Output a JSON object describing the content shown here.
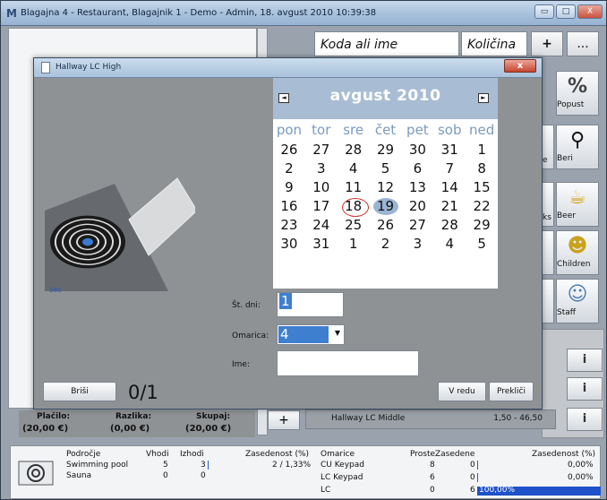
{
  "window": {
    "title": "Blagajna 4 - Restaurant, Blagajnik 1 - Demo - Admin, 18. avgust 2010 10:39:38",
    "app_icon": "M",
    "btn_min": "▭",
    "btn_max": "□",
    "btn_close": "X"
  },
  "toolbar": {
    "search_placeholder": "Koda ali ime",
    "qty_placeholder": "Količina",
    "plus": "+",
    "more": "..."
  },
  "tiles": [
    {
      "label": "Popust",
      "icon": "percent-icon"
    },
    {
      "label": "Beri",
      "icon": "magnifier-icon"
    },
    {
      "label": "Beer",
      "icon": "beer-icon"
    },
    {
      "label": "Children",
      "icon": "children-icon"
    },
    {
      "label": "Staff",
      "icon": "staff-icon"
    }
  ],
  "side_labels": {
    "ks": "ks",
    "e": "e"
  },
  "info_buttons": [
    "i",
    "i",
    "i"
  ],
  "dialog": {
    "title": "Hallway LC High",
    "close": "x",
    "image_label": "360",
    "calendar": {
      "month": "avgust 2010",
      "prev": "◄",
      "next": "►",
      "weekdays": [
        "pon",
        "tor",
        "sre",
        "čet",
        "pet",
        "sob",
        "ned"
      ],
      "weeks": [
        [
          "26",
          "27",
          "28",
          "29",
          "30",
          "31",
          "1"
        ],
        [
          "2",
          "3",
          "4",
          "5",
          "6",
          "7",
          "8"
        ],
        [
          "9",
          "10",
          "11",
          "12",
          "13",
          "14",
          "15"
        ],
        [
          "16",
          "17",
          "18",
          "19",
          "20",
          "21",
          "22"
        ],
        [
          "23",
          "24",
          "25",
          "26",
          "27",
          "28",
          "29"
        ],
        [
          "30",
          "31",
          "1",
          "2",
          "3",
          "4",
          "5"
        ]
      ],
      "today": "18",
      "selected": "19"
    },
    "days_label": "Št. dni:",
    "days_value": "1",
    "locker_label": "Omarica:",
    "locker_value": "4",
    "name_label": "Ime:",
    "name_value": "",
    "delete_label": "Briši",
    "counter": "0/1",
    "ok_label": "V redu",
    "cancel_label": "Prekliči"
  },
  "totals": {
    "paid_label": "Plačilo:",
    "paid_value": "(20,00 €)",
    "diff_label": "Razlika:",
    "diff_value": "(0,00 €)",
    "total_label": "Skupaj:",
    "total_value": "(20,00 €)"
  },
  "order_row": {
    "plus": "+",
    "name": "Hallway LC Middle",
    "price": "1,50 - 46,50"
  },
  "bottom": {
    "areas_headers": [
      "Področje",
      "Vhodi",
      "Izhodi",
      "Zasedenost (%)"
    ],
    "areas": [
      {
        "name": "Swimming pool",
        "in": "5",
        "out": "3",
        "occ": "2 / 1,33%"
      },
      {
        "name": "Sauna",
        "in": "0",
        "out": "0",
        "occ": ""
      }
    ],
    "lockers_headers": [
      "Omarice",
      "Proste",
      "Zasedene",
      "Zasedenost (%)"
    ],
    "lockers": [
      {
        "name": "CU Keypad",
        "free": "8",
        "used": "0",
        "occ": "0,00%"
      },
      {
        "name": "LC Keypad",
        "free": "6",
        "used": "0",
        "occ": "0,00%"
      },
      {
        "name": "LC",
        "free": "0",
        "used": "6",
        "occ": "100,00%",
        "fill": 1.0
      }
    ]
  }
}
